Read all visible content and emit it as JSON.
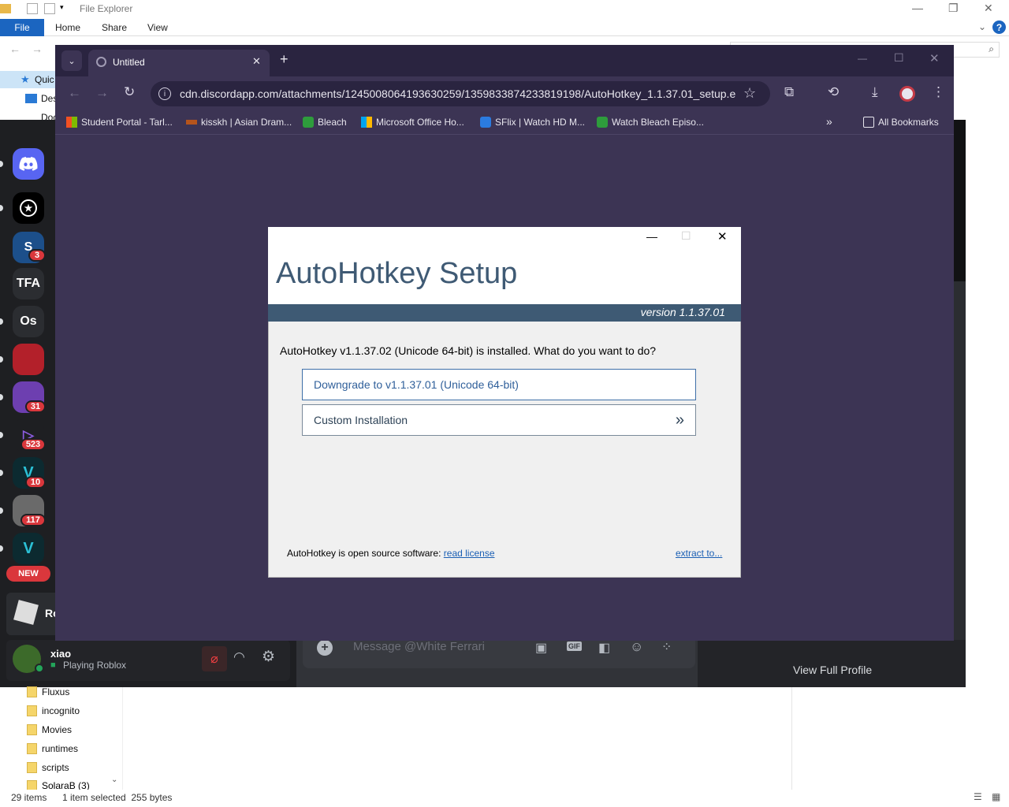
{
  "explorer": {
    "title": "File Explorer",
    "tabs": [
      "File",
      "Home",
      "Share",
      "View"
    ],
    "quick_access": [
      "Quic",
      "Des",
      "Doc"
    ],
    "folders": [
      "Fluxus",
      "incognito",
      "Movies",
      "runtimes",
      "scripts",
      "SolaraB (3)"
    ],
    "status_items": "29 items",
    "status_selected": "1 item selected  255 bytes"
  },
  "discord": {
    "servers": [
      {
        "label": "",
        "badge": ""
      },
      {
        "label": "",
        "badge": ""
      },
      {
        "label": "S",
        "badge": "3"
      },
      {
        "label": "TFA",
        "badge": ""
      },
      {
        "label": "Os",
        "badge": ""
      },
      {
        "label": "",
        "badge": ""
      },
      {
        "label": "",
        "badge": "31"
      },
      {
        "label": "",
        "badge": "523"
      },
      {
        "label": "",
        "badge": "10"
      },
      {
        "label": "",
        "badge": "117"
      },
      {
        "label": "",
        "badge": ""
      }
    ],
    "new_badge": "NEW",
    "game_name": "Ro",
    "user_name": "xiao",
    "user_status": "Playing Roblox",
    "message_placeholder": "Message @White Ferrari",
    "view_profile": "View Full Profile"
  },
  "chrome": {
    "tab_title": "Untitled",
    "url": "cdn.discordapp.com/attachments/1245008064193630259/1359833874233819198/AutoHotkey_1.1.37.01_setup.e...",
    "bookmarks": [
      {
        "label": "Student Portal - Tarl...",
        "color": "#f25022"
      },
      {
        "label": "kisskh | Asian Dram...",
        "color": "#b5541c"
      },
      {
        "label": "Bleach",
        "color": "#2e9c3c"
      },
      {
        "label": "Microsoft Office Ho...",
        "color": "#7fba00"
      },
      {
        "label": "SFlix | Watch HD M...",
        "color": "#2b7be0"
      },
      {
        "label": "Watch Bleach Episo...",
        "color": "#2e9c3c"
      }
    ],
    "all_bookmarks": "All Bookmarks"
  },
  "setup": {
    "title": "AutoHotkey Setup",
    "version": "version 1.1.37.01",
    "question": "AutoHotkey v1.1.37.02 (Unicode 64-bit) is installed. What do you want to do?",
    "option1": "Downgrade to v1.1.37.01 (Unicode 64-bit)",
    "option2": "Custom Installation",
    "option2_arrow": "»",
    "footer_text": "AutoHotkey is open source software: ",
    "footer_link": "read license",
    "extract": "extract to..."
  }
}
